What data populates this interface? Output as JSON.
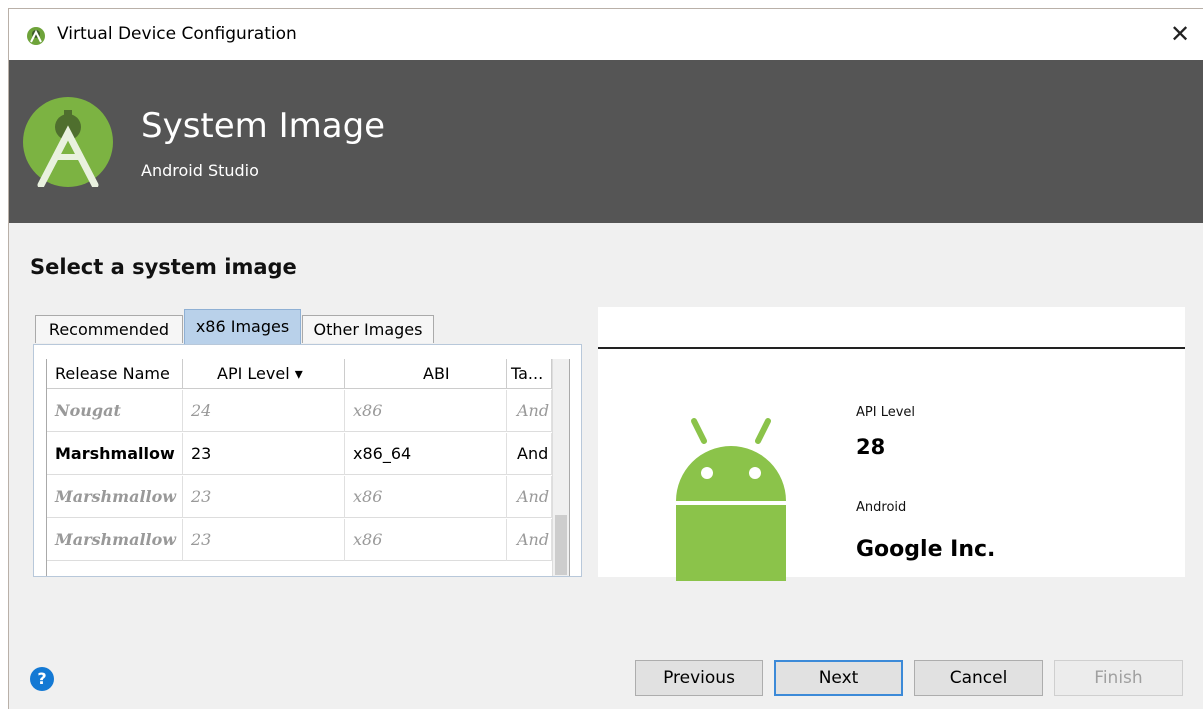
{
  "window": {
    "title": "Virtual Device Configuration",
    "close_glyph": "✕"
  },
  "banner": {
    "title": "System Image",
    "subtitle": "Android Studio"
  },
  "heading": "Select a system image",
  "tabs": [
    {
      "label": "Recommended",
      "active": false
    },
    {
      "label": "x86 Images",
      "active": true
    },
    {
      "label": "Other Images",
      "active": false
    }
  ],
  "table": {
    "columns": [
      "Release Name",
      "API Level ▾",
      "ABI",
      "Ta..."
    ],
    "rows": [
      {
        "name": "Nougat",
        "api": "24",
        "abi": "x86",
        "target": "And",
        "style": "dim"
      },
      {
        "name": "Marshmallow",
        "api": "23",
        "abi": "x86_64",
        "target": "And",
        "style": "bold"
      },
      {
        "name": "Marshmallow",
        "api": "23",
        "abi": "x86",
        "target": "And",
        "style": "dim"
      },
      {
        "name": "Marshmallow",
        "api": "23",
        "abi": "x86",
        "target": "And",
        "style": "dim"
      }
    ]
  },
  "detail": {
    "api_label": "API Level",
    "api_value": "28",
    "os_label": "Android",
    "vendor": "Google Inc."
  },
  "footer": {
    "help": "?",
    "previous": "Previous",
    "next": "Next",
    "cancel": "Cancel",
    "finish": "Finish"
  },
  "colors": {
    "banner": "#555555",
    "android_green": "#8bc34a",
    "accent": "#3c8ad8",
    "help_blue": "#1479d4"
  }
}
